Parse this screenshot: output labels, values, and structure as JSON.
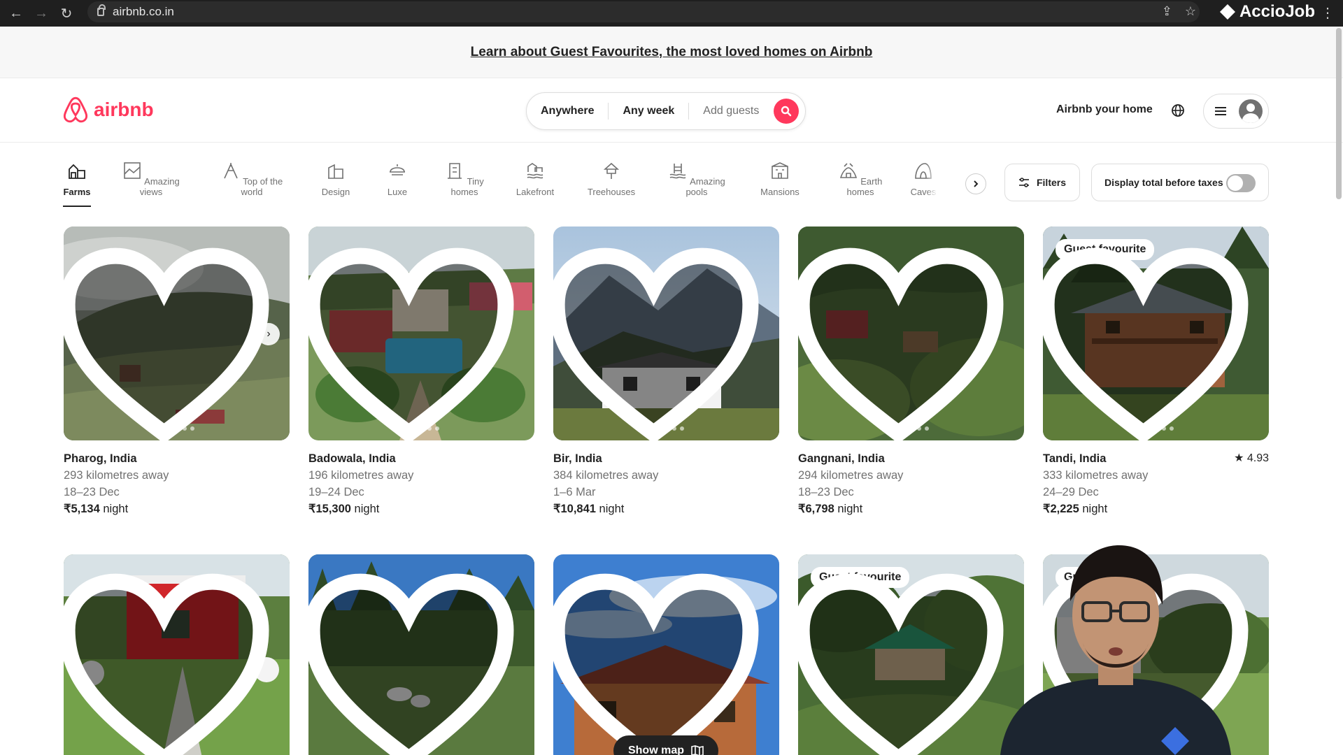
{
  "browser": {
    "url": "airbnb.co.in",
    "brand": "AccioJob"
  },
  "banner": {
    "text": "Learn about Guest Favourites, the most loved homes on Airbnb"
  },
  "header": {
    "logo_text": "airbnb",
    "search": {
      "location": "Anywhere",
      "dates": "Any week",
      "guests": "Add guests"
    },
    "host_link": "Airbnb your home"
  },
  "categories": [
    {
      "label": "Farms",
      "icon": "farm-icon"
    },
    {
      "label": "Amazing views",
      "icon": "views-icon"
    },
    {
      "label": "Top of the world",
      "icon": "mountain-icon"
    },
    {
      "label": "Design",
      "icon": "design-icon"
    },
    {
      "label": "Luxe",
      "icon": "luxe-icon"
    },
    {
      "label": "Tiny homes",
      "icon": "tiny-home-icon"
    },
    {
      "label": "Lakefront",
      "icon": "lake-icon"
    },
    {
      "label": "Treehouses",
      "icon": "treehouse-icon"
    },
    {
      "label": "Amazing pools",
      "icon": "pool-icon"
    },
    {
      "label": "Mansions",
      "icon": "mansion-icon"
    },
    {
      "label": "Earth homes",
      "icon": "earth-home-icon"
    },
    {
      "label": "Caves",
      "icon": "cave-icon"
    }
  ],
  "filters_label": "Filters",
  "taxes_label": "Display total before taxes",
  "listings": [
    {
      "title": "Pharog, India",
      "distance": "293 kilometres away",
      "dates": "18–23 Dec",
      "price": "₹5,134",
      "per": " night"
    },
    {
      "title": "Badowala, India",
      "distance": "196 kilometres away",
      "dates": "19–24 Dec",
      "price": "₹15,300",
      "per": " night"
    },
    {
      "title": "Bir, India",
      "distance": "384 kilometres away",
      "dates": "1–6 Mar",
      "price": "₹10,841",
      "per": " night"
    },
    {
      "title": "Gangnani, India",
      "distance": "294 kilometres away",
      "dates": "18–23 Dec",
      "price": "₹6,798",
      "per": " night"
    },
    {
      "title": "Tandi, India",
      "distance": "333 kilometres away",
      "dates": "24–29 Dec",
      "price": "₹2,225",
      "per": " night",
      "rating": "4.93",
      "badge": "Guest favourite"
    }
  ],
  "row2_badges": [
    "Guest favourite",
    "Gue"
  ],
  "show_map_label": "Show map"
}
